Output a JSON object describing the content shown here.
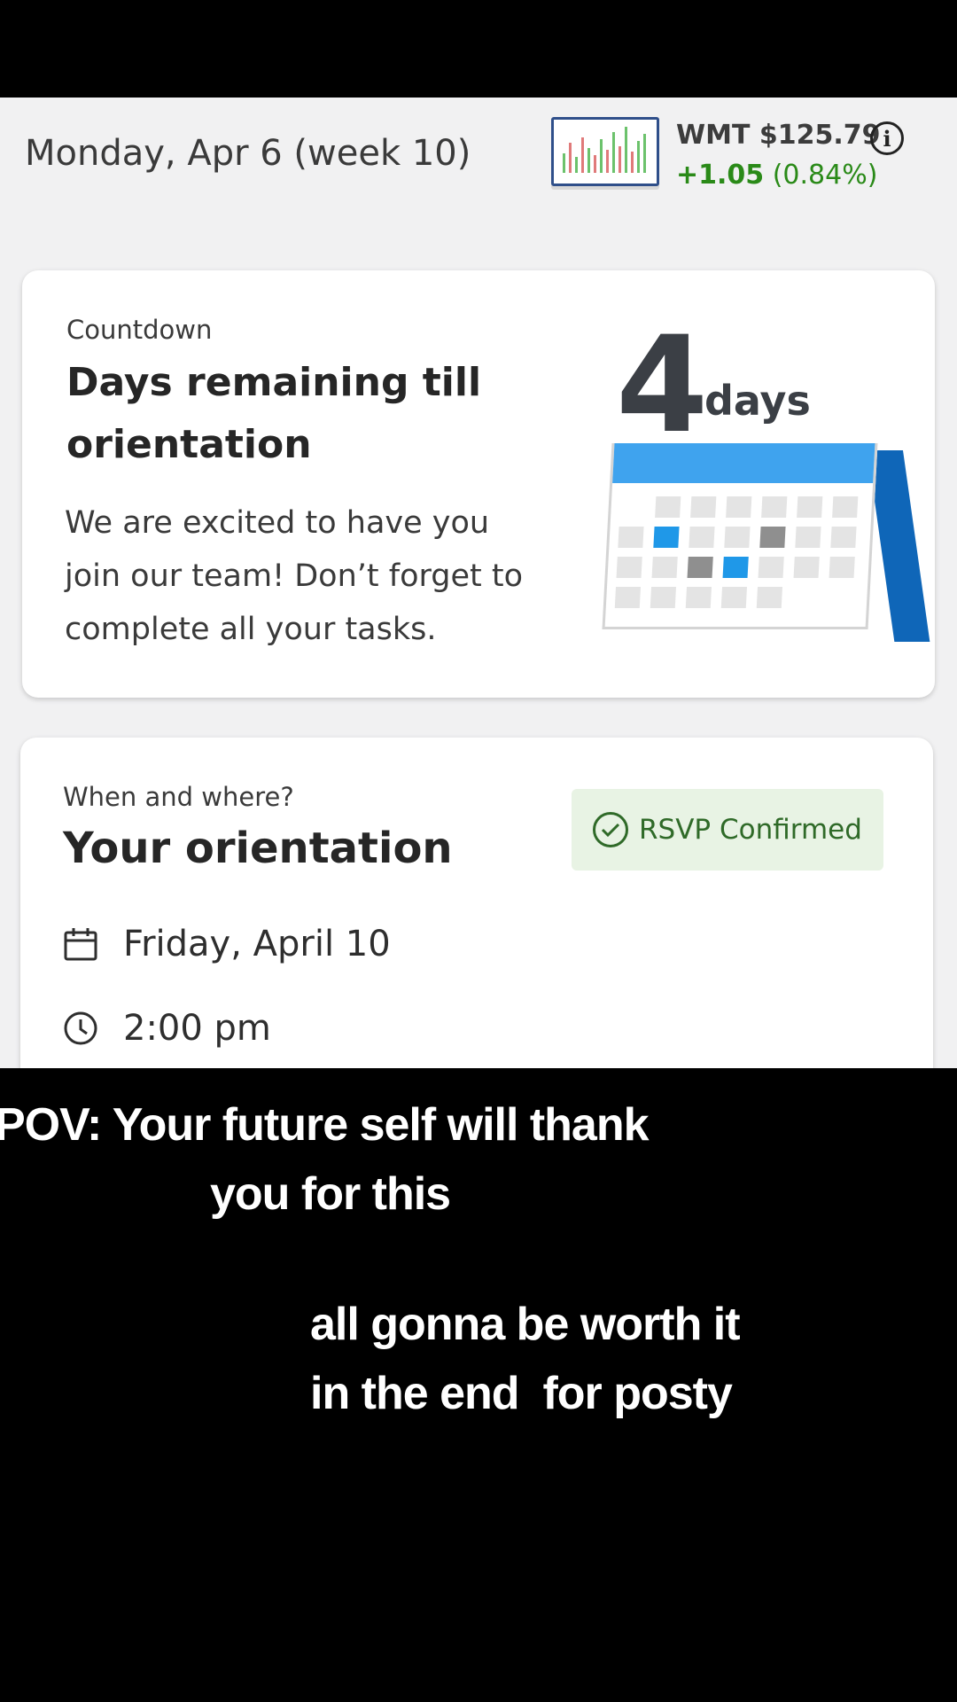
{
  "header": {
    "date": "Monday, Apr 6 (week 10)",
    "stock": {
      "ticker_price": "WMT $125.79",
      "change": "+1.05",
      "change_pct": "(0.84%)",
      "info_glyph": "i",
      "thumbnail_icon": "stock-chart-icon"
    }
  },
  "countdown_card": {
    "eyebrow": "Countdown",
    "title_line1": "Days remaining till",
    "title_line2": "orientation",
    "body_line1": "We are excited to have you",
    "body_line2": "join our team! Don’t forget to",
    "body_line3": "complete all your tasks.",
    "illustration": {
      "number": "4",
      "unit": "days",
      "icon": "calendar-icon"
    }
  },
  "orientation_card": {
    "eyebrow": "When and where?",
    "title": "Your orientation",
    "rsvp_label": "RSVP Confirmed",
    "date": "Friday, April 10",
    "time": "2:00 pm"
  },
  "caption": {
    "line1": "POV: Your future self will thank",
    "line2": "you for this",
    "line3": "all gonna be worth it",
    "line4": "in the end  for posty"
  },
  "colors": {
    "positive": "#2a8a18",
    "rsvp_bg": "#e8f3e4",
    "calendar_accent": "#3fa3ee"
  }
}
